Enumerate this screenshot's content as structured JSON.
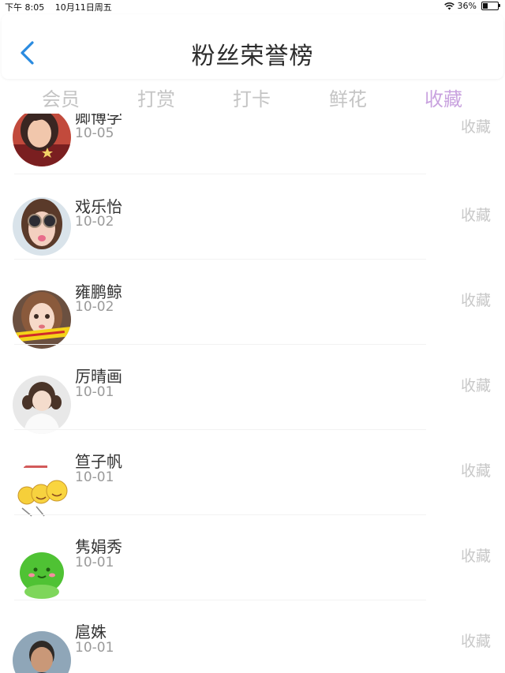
{
  "status_bar": {
    "time": "下午 8:05",
    "date": "10月11日周五",
    "battery": "36%",
    "battery_level": 0.36
  },
  "header": {
    "title": "粉丝荣誉榜"
  },
  "tabs": [
    {
      "label": "会员",
      "active": false
    },
    {
      "label": "打赏",
      "active": false
    },
    {
      "label": "打卡",
      "active": false
    },
    {
      "label": "鲜花",
      "active": false
    },
    {
      "label": "收藏",
      "active": true
    }
  ],
  "colors": {
    "accent": "#c9a3df",
    "back_icon": "#2a8be0",
    "muted": "#c8c8c8"
  },
  "list": [
    {
      "name": "卿博学",
      "date": "10-05",
      "action": "收藏",
      "avatar": "girl-portrait"
    },
    {
      "name": "戏乐怡",
      "date": "10-02",
      "action": "收藏",
      "avatar": "girl-sunglasses"
    },
    {
      "name": "雍鹏鲸",
      "date": "10-02",
      "action": "收藏",
      "avatar": "girl-with-banner"
    },
    {
      "name": "厉晴画",
      "date": "10-01",
      "action": "收藏",
      "avatar": "girl-pigtails"
    },
    {
      "name": "笪子帆",
      "date": "10-01",
      "action": "收藏",
      "avatar": "emoji-faces"
    },
    {
      "name": "隽娟秀",
      "date": "10-01",
      "action": "收藏",
      "avatar": "green-bean-cartoon"
    },
    {
      "name": "扈姝",
      "date": "10-01",
      "action": "收藏",
      "avatar": "man-portrait"
    }
  ]
}
